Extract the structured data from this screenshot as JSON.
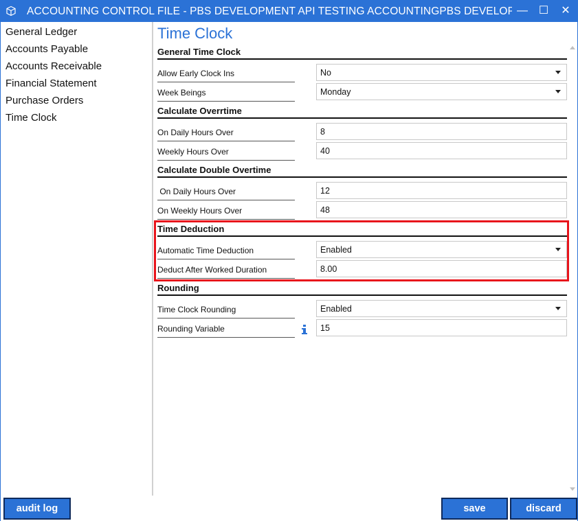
{
  "window": {
    "title": "ACCOUNTING CONTROL FILE - PBS DEVELOPMENT API TESTING ACCOUNTINGPBS DEVELOPMENT A...",
    "controls": {
      "minimize": "—",
      "maximize": "☐",
      "close": "✕"
    },
    "accent_color": "#2b72d6"
  },
  "sidebar": {
    "items": [
      {
        "label": "General Ledger"
      },
      {
        "label": "Accounts Payable"
      },
      {
        "label": "Accounts Receivable"
      },
      {
        "label": "Financial Statement"
      },
      {
        "label": "Purchase Orders"
      },
      {
        "label": "Time Clock"
      }
    ]
  },
  "main": {
    "page_title": "Time Clock",
    "sections": {
      "general": {
        "title": "General Time Clock",
        "fields": [
          {
            "label": "Allow Early Clock Ins",
            "value": "No",
            "type": "select"
          },
          {
            "label": "Week Beings",
            "value": "Monday",
            "type": "select"
          }
        ]
      },
      "overtime": {
        "title": "Calculate Overrtime",
        "fields": [
          {
            "label": "On Daily Hours Over",
            "value": "8",
            "type": "input"
          },
          {
            "label": "Weekly Hours Over",
            "value": "40",
            "type": "input"
          }
        ]
      },
      "double_overtime": {
        "title": "Calculate Double Overtime",
        "fields": [
          {
            "label": " On Daily Hours Over",
            "value": "12",
            "type": "input"
          },
          {
            "label": "On Weekly Hours Over",
            "value": "48",
            "type": "input"
          }
        ]
      },
      "deduction": {
        "title": "Time Deduction",
        "highlight_color": "#e8131b",
        "fields": [
          {
            "label": "Automatic Time Deduction",
            "value": "Enabled",
            "type": "select"
          },
          {
            "label": "Deduct After Worked Duration",
            "value": "8.00",
            "type": "input"
          }
        ]
      },
      "rounding": {
        "title": "Rounding",
        "fields": [
          {
            "label": "Time Clock Rounding",
            "value": "Enabled",
            "type": "select"
          },
          {
            "label": "Rounding Variable",
            "value": "15",
            "type": "input",
            "icon": "info-icon"
          }
        ]
      }
    }
  },
  "footer": {
    "audit_log": "audit log",
    "save": "save",
    "discard": "discard"
  }
}
